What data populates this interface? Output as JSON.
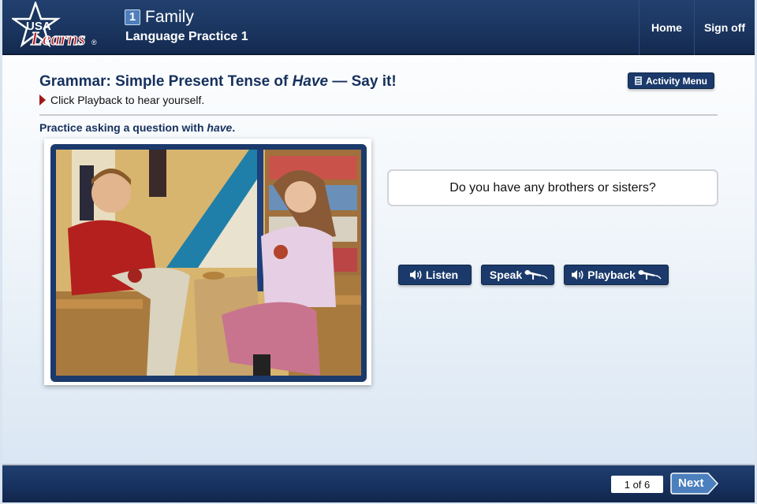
{
  "header": {
    "logo": {
      "line1": "USA",
      "line2": "Learns",
      "mark": "®"
    },
    "unit_number": "1",
    "unit_title": "Family",
    "lesson_title": "Language Practice 1",
    "nav": [
      {
        "label": "Home"
      },
      {
        "label": "Sign off"
      }
    ]
  },
  "activity": {
    "title_prefix": "Grammar: Simple Present Tense of ",
    "title_emphasis": "Have",
    "title_suffix": " — Say it!",
    "instruction": "Click Playback to hear yourself.",
    "menu_button": "Activity Menu",
    "menu_icon": "book-icon",
    "prompt_prefix": "Practice asking a question with ",
    "prompt_emphasis": "have",
    "prompt_suffix": ".",
    "video_description": "Man in red sweater and woman in pink sweater sitting at a table holding mugs",
    "question": "Do you have any brothers or sisters?"
  },
  "buttons": [
    {
      "label": "Listen",
      "icon": "speaker-icon"
    },
    {
      "label": "Speak",
      "icon": "microphone-icon"
    },
    {
      "label": "Playback",
      "icon": "speaker-microphone-icon"
    }
  ],
  "footer": {
    "page_indicator": "1 of 6",
    "current_page": 1,
    "total_pages": 6,
    "next_label": "Next"
  },
  "colors": {
    "navy": "#1b3a6b",
    "header": "#1a345e",
    "title_text": "#16305d",
    "accent_red": "#a01818",
    "next_blue": "#4b7fbe"
  }
}
